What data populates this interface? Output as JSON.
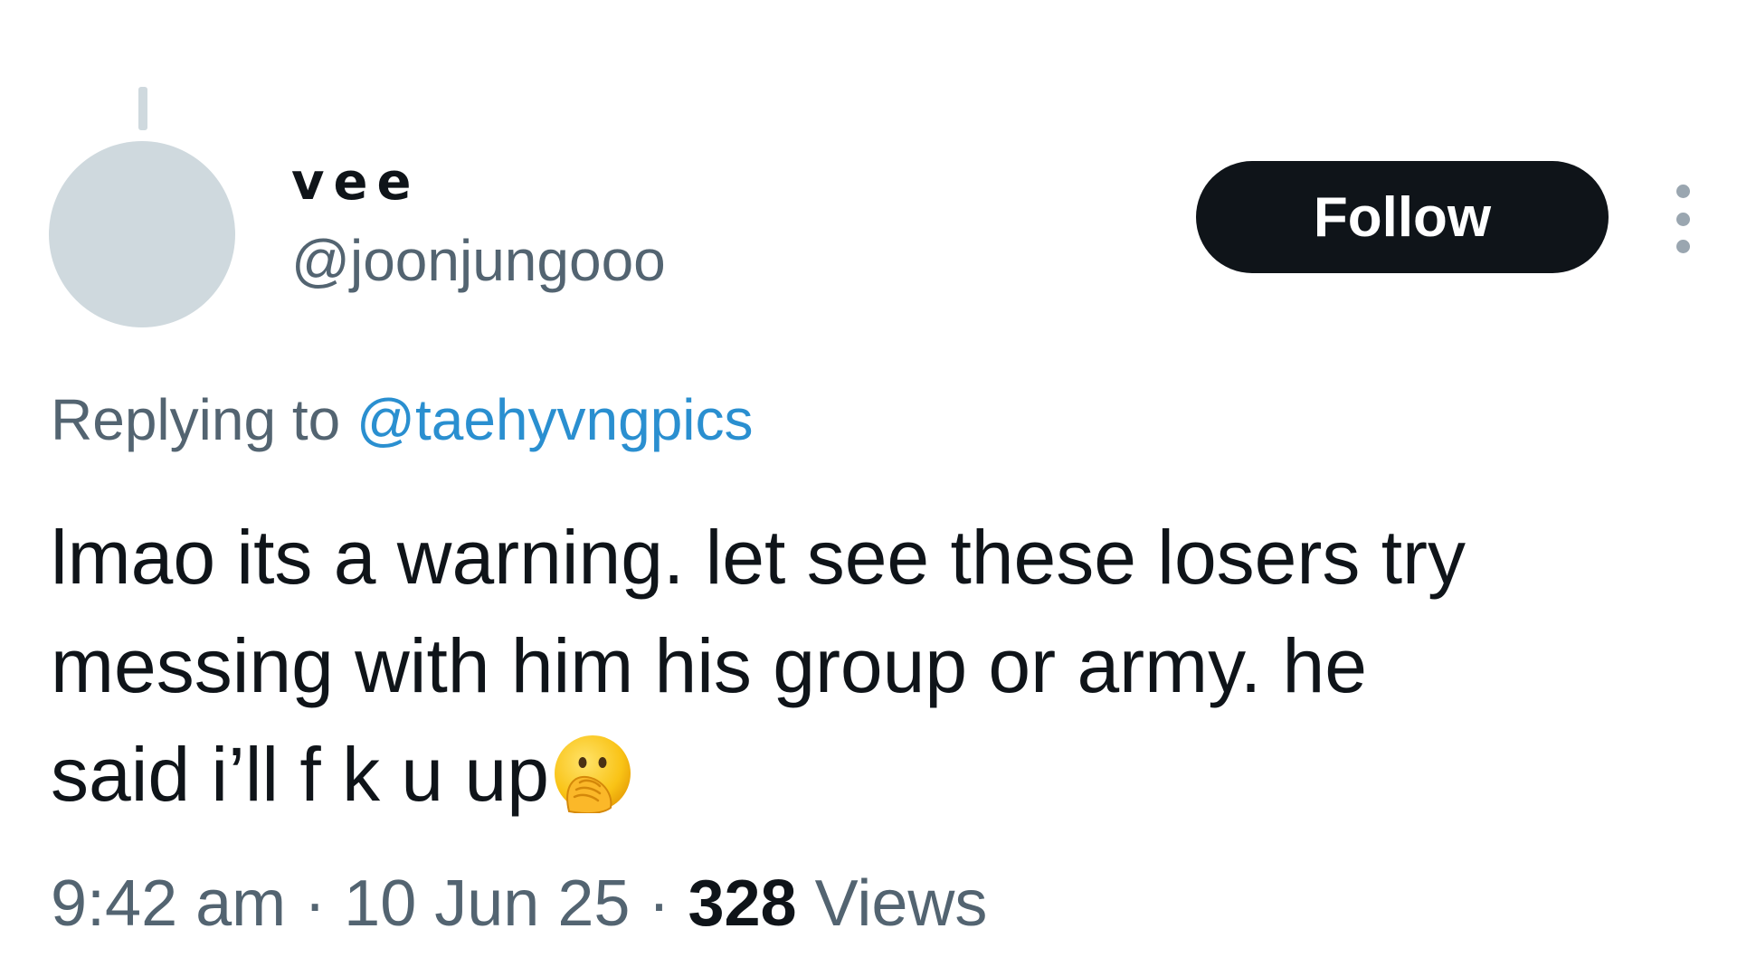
{
  "user": {
    "display_name": "vee",
    "handle": "@joonjungooo"
  },
  "follow_label": "Follow",
  "more_icon": "more-vertical-icon",
  "reply": {
    "prefix": "Replying to",
    "mention": "@taehyvngpics"
  },
  "tweet": {
    "lines": [
      "lmao its a warning. let see these losers try",
      "messing with him his group or army. he",
      "said i’ll f  k u up"
    ],
    "emoji": "face-with-hand-over-mouth-emoji"
  },
  "meta": {
    "time": "9:42 am",
    "separator": "·",
    "date": "10 Jun 25",
    "views_count": "328",
    "views_label": "Views"
  },
  "colors": {
    "text_primary": "#0f1419",
    "text_secondary": "#536471",
    "link": "#2a8fd0",
    "avatar_placeholder": "#cfd9de",
    "follow_button_bg": "#0f1419"
  }
}
